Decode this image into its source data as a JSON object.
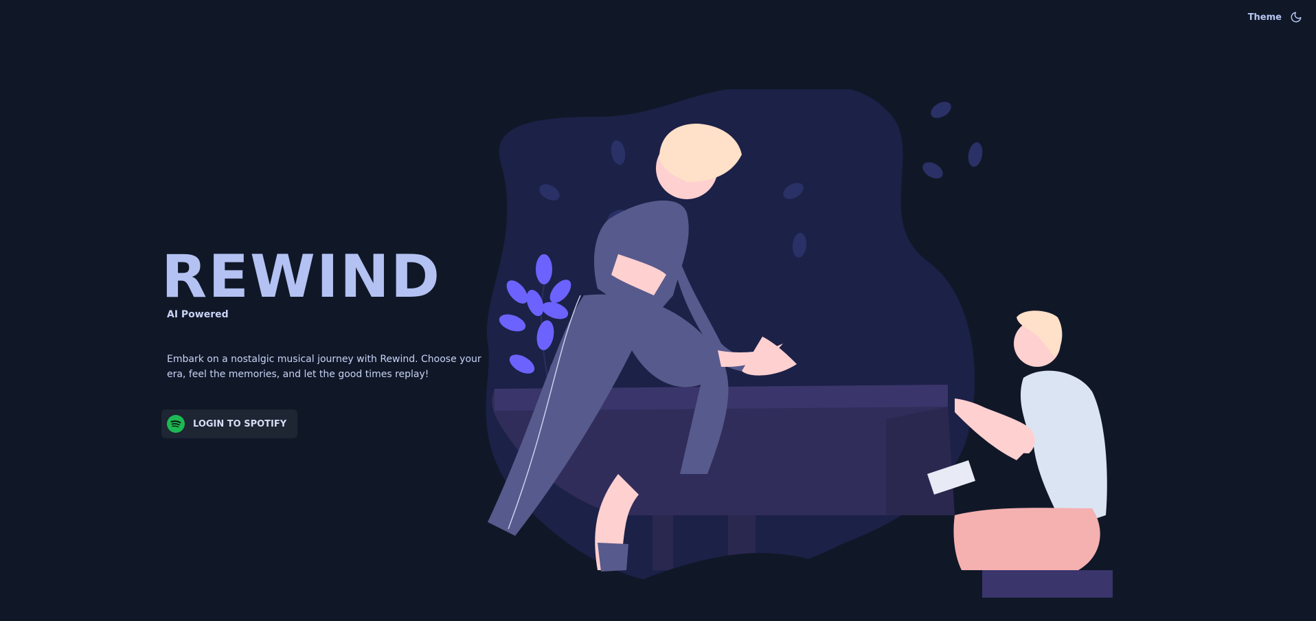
{
  "topbar": {
    "theme_label": "Theme",
    "theme_icon": "moon-icon"
  },
  "hero": {
    "title": "REWIND",
    "subtitle": "AI Powered",
    "description": "Embark on a nostalgic musical journey with Rewind. Choose your era, feel the memories, and let the good times replay!"
  },
  "login": {
    "label": "LOGIN TO SPOTIFY",
    "icon": "spotify-icon",
    "icon_color": "#1DB954"
  },
  "colors": {
    "background": "#101828",
    "title": "#b3c2f2",
    "blob": "#1c2147",
    "piano": "#312d5a",
    "accent_purple": "#6c63ff"
  }
}
